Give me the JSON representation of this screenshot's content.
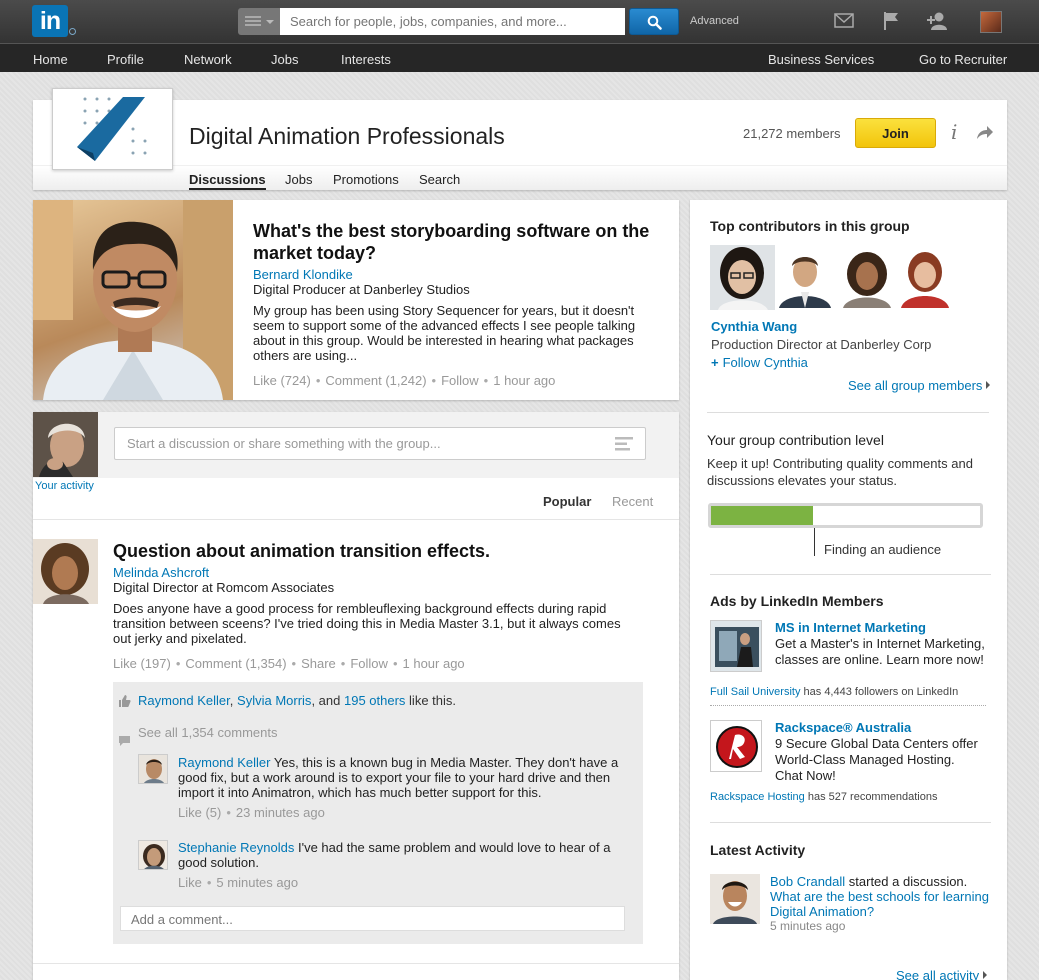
{
  "topbar": {
    "logo": "in",
    "search_placeholder": "Search for people, jobs, companies, and more...",
    "advanced": "Advanced"
  },
  "nav": {
    "items": [
      "Home",
      "Profile",
      "Network",
      "Jobs",
      "Interests"
    ],
    "right": [
      "Business Services",
      "Go to Recruiter"
    ]
  },
  "group": {
    "title": "Digital Animation Professionals",
    "members": "21,272 members",
    "join_label": "Join",
    "info_label": "i",
    "tabs": [
      "Discussions",
      "Jobs",
      "Promotions",
      "Search"
    ]
  },
  "featured": {
    "title": "What's the best storyboarding software on the market today?",
    "author": "Bernard Klondike",
    "role": "Digital Producer at Danberley Studios",
    "body": "My group has been using Story Sequencer for years, but it doesn't seem to support some of the advanced effects I see people talking about in this group. Would be interested in hearing what packages others are using...",
    "meta": [
      "Like (724)",
      "Comment (1,242)",
      "Follow",
      "1 hour ago"
    ]
  },
  "composer": {
    "your_activity": "Your activity",
    "placeholder": "Start a discussion or share something with the group..."
  },
  "sort": {
    "popular": "Popular",
    "recent": "Recent"
  },
  "post": {
    "title": "Question about animation transition effects.",
    "author": "Melinda Ashcroft",
    "role": "Digital Director at Romcom Associates",
    "body": "Does anyone have a good process for rembleuflexing background effects during rapid transition between sceens? I've tried doing this in Media Master 3.1, but it always comes out jerky and pixelated.",
    "meta": [
      "Like (197)",
      "Comment (1,354)",
      "Share",
      "Follow",
      "1 hour ago"
    ],
    "likes": {
      "name1": "Raymond Keller",
      "comma": ",",
      "name2": "Sylvia Morris",
      "and": ", and",
      "others": "195 others",
      "suffix": "like this."
    },
    "see_all_comments": "See all 1,354 comments",
    "comments": [
      {
        "author": "Raymond Keller",
        "text": " Yes, this is a known bug in Media Master. They don't have a good fix, but a work around is to export your file to your hard drive and then import it into Animatron, which has much better support for this.",
        "meta": [
          "Like (5)",
          "23 minutes ago"
        ]
      },
      {
        "author": "Stephanie Reynolds",
        "text": " I've had the same problem and would love to hear of a good solution.",
        "meta": [
          "Like",
          "5 minutes ago"
        ]
      }
    ],
    "add_comment_placeholder": "Add a comment..."
  },
  "sidebar": {
    "top_contributors_heading": "Top contributors in this group",
    "contributor": {
      "name": "Cynthia Wang",
      "role": "Production Director at Danberley Corp",
      "follow": "Follow Cynthia"
    },
    "see_all_members": "See all group members",
    "contribution_heading": "Your group contribution level",
    "contribution_desc": "Keep it up! Contributing quality comments and discussions elevates your status.",
    "contribution_progress": 0.38,
    "contribution_label": "Finding an audience",
    "ads_heading": "Ads by LinkedIn Members",
    "ads": [
      {
        "title": "MS in Internet Marketing",
        "text": "Get a Master's in Internet Marketing, classes are online. Learn more now!",
        "org": "Full Sail University",
        "foot": " has 4,443 followers on LinkedIn"
      },
      {
        "title": "Rackspace® Australia",
        "text": "9 Secure Global Data Centers offer World-Class Managed Hosting. Chat Now!",
        "org": "Rackspace Hosting",
        "foot": " has 527 recommendations"
      }
    ],
    "latest_heading": "Latest Activity",
    "latest": {
      "actor": "Bob Crandall",
      "action": " started a discussion.",
      "link": "What are the best schools for learning Digital Animation?",
      "time": "5 minutes ago"
    },
    "see_all_activity": "See all activity"
  },
  "colors": {
    "brand": "#0a74b5",
    "link": "#0077b5",
    "join": "#f7d021",
    "progress": "#7cb342"
  }
}
